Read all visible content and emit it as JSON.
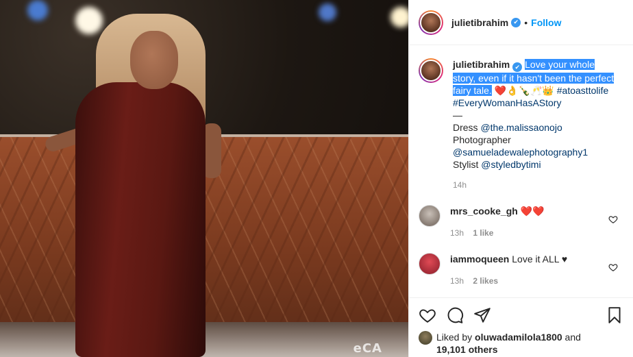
{
  "post": {
    "watermark": "eCA",
    "author": {
      "username": "julietibrahim",
      "verified_icon": "verified-badge-icon",
      "follow_label": "Follow"
    },
    "caption": {
      "username": "julietibrahim",
      "highlighted_text": "Love your whole story, even if it hasn't been the perfect fairy tale.",
      "emojis": "❤️👌🍾🥂👑",
      "hashtag1": "#atoasttolife",
      "hashtag2": "#EveryWomanHasAStory",
      "separator": "—",
      "dress_label": "Dress",
      "dress_handle": "@the.malissaonojo",
      "photographer_label": "Photographer",
      "photographer_handle": "@samueladewalephotography1",
      "stylist_label": "Stylist",
      "stylist_handle": "@styledbytimi",
      "time": "14h"
    },
    "comments": [
      {
        "username": "mrs_cooke_gh",
        "text": "❤️❤️",
        "time": "13h",
        "likes": "1 like"
      },
      {
        "username": "iammoqueen",
        "text": "Love it ALL ♥",
        "time": "13h",
        "likes": "2 likes"
      }
    ],
    "likes": {
      "prefix": "Liked by",
      "user": "oluwadamilola1800",
      "and": "and",
      "others": "19,101 others"
    }
  },
  "colors": {
    "accent": "#0095f6",
    "highlight": "#3390ff",
    "hashtag": "#00376b"
  }
}
